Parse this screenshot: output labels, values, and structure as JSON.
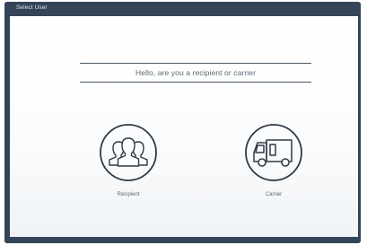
{
  "window": {
    "title": "Select User"
  },
  "prompt": {
    "text": "Hello, are you a recipient or carrier"
  },
  "choices": [
    {
      "label": "Recipient",
      "icon": "group-of-people-icon"
    },
    {
      "label": "Carrier",
      "icon": "delivery-truck-icon"
    }
  ],
  "colors": {
    "frame": "#334557",
    "icon_stroke": "#2f3a46",
    "text": "#5d6873"
  }
}
